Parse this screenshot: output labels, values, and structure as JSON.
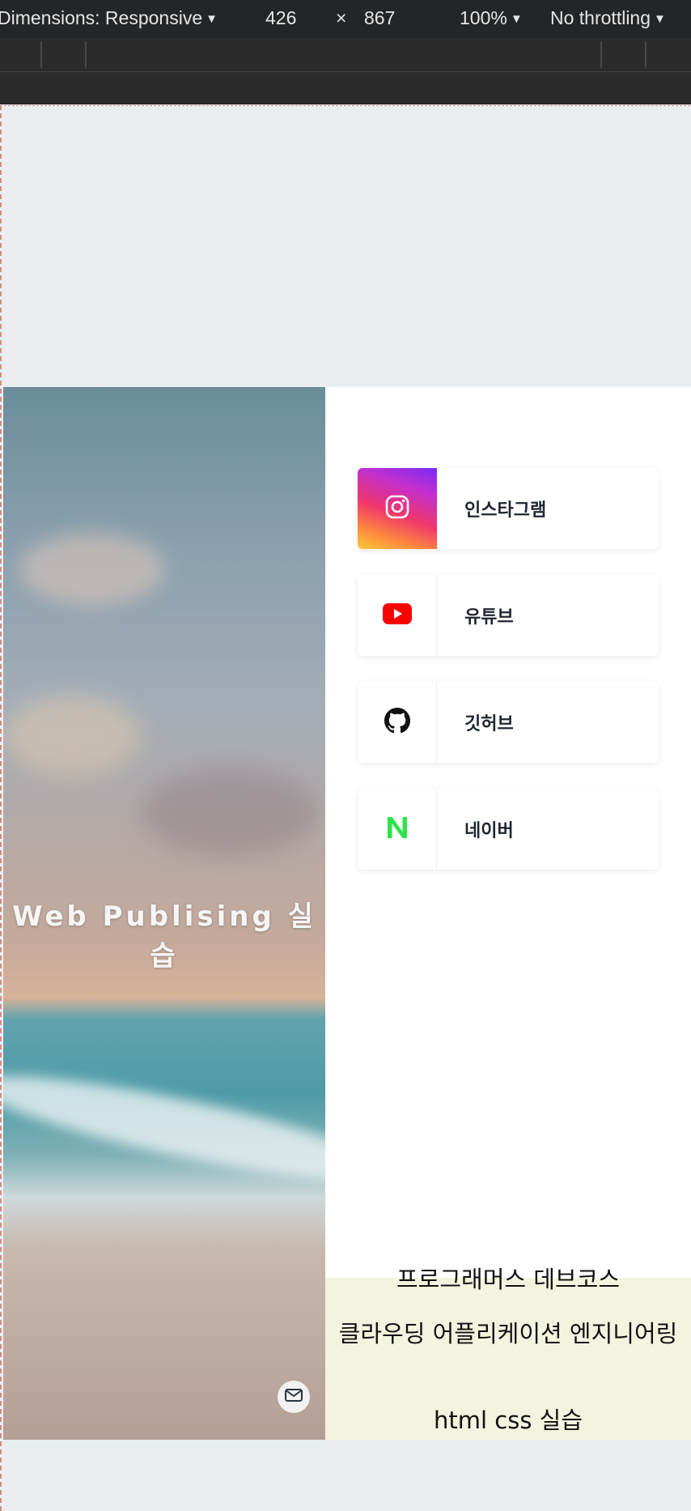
{
  "devtools": {
    "dimensions_label": "Dimensions: Responsive",
    "width": "426",
    "times": "×",
    "height": "867",
    "zoom": "100%",
    "throttle": "No throttling"
  },
  "hero": {
    "title": "Web Publising 실습"
  },
  "links": [
    {
      "label": "인스타그램",
      "icon": "instagram-icon"
    },
    {
      "label": "유튜브",
      "icon": "youtube-icon"
    },
    {
      "label": "깃허브",
      "icon": "github-icon"
    },
    {
      "label": "네이버",
      "icon": "naver-icon"
    }
  ],
  "footer": {
    "line1": "프로그래머스 데브코스",
    "line2": "클라우딩 어플리케이션 엔지니어링",
    "line3": "html css 실습"
  },
  "colors": {
    "youtube": "#ff0000",
    "naver": "#2de34a",
    "footer_bg": "#f4f3df"
  }
}
